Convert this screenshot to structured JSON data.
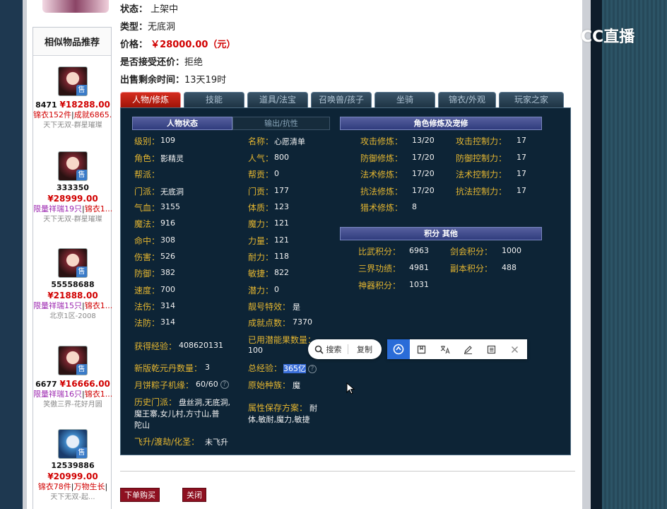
{
  "watermark": {
    "text": "CC直播"
  },
  "sidebar": {
    "title": "相似物品推荐",
    "sale_badge": "售",
    "items": [
      {
        "id": "8471",
        "price": "¥18288.00",
        "tag1": "锦衣152件",
        "tag2": "成就6865...",
        "server": "天下无双-群星璀璨"
      },
      {
        "id": "333350",
        "price": "¥28999.00",
        "tag1": "限量祥瑞19只",
        "tag2": "锦衣1...",
        "server": "天下无双-群星璀璨"
      },
      {
        "id": "55558688",
        "price": "¥21888.00",
        "tag1": "限量祥瑞15只",
        "tag2": "锦衣1...",
        "server": "北京1区-2008"
      },
      {
        "id": "6677",
        "price": "¥16666.00",
        "tag1": "限量祥瑞16只",
        "tag2": "锦衣1...",
        "server": "笑傲三界-花好月圆"
      },
      {
        "id": "12539886",
        "price": "¥20999.00",
        "tag1": "锦衣78件",
        "tag2": "万物生长",
        "server": "天下无双-起..."
      }
    ]
  },
  "info": {
    "status_label": "状态：",
    "status_value": "上架中",
    "type_label": "类型：",
    "type_value": "无底洞",
    "price_label": "价格：",
    "price_value": "￥28000.00（元）",
    "bargain_label": "是否接受还价：",
    "bargain_value": "拒绝",
    "remain_label": "出售剩余时间：",
    "remain_value": "13天19时"
  },
  "tabs": [
    "人物/修炼",
    "技能",
    "道具/法宝",
    "召唤兽/孩子",
    "坐骑",
    "锦衣/外观",
    "玩家之家"
  ],
  "sections": {
    "status": "人物状态",
    "output": "输出/抗性",
    "cultivation": "角色修炼及宠修",
    "points": "积分 其他"
  },
  "stats_left": [
    {
      "label": "级别：",
      "value": "109"
    },
    {
      "label": "角色：",
      "value": "影精灵"
    },
    {
      "label": "帮派：",
      "value": ""
    },
    {
      "label": "门派：",
      "value": "无底洞"
    },
    {
      "label": "气血：",
      "value": "3155"
    },
    {
      "label": "魔法：",
      "value": "916"
    },
    {
      "label": "命中：",
      "value": "308"
    },
    {
      "label": "伤害：",
      "value": "526"
    },
    {
      "label": "防御：",
      "value": "382"
    },
    {
      "label": "速度：",
      "value": "700"
    },
    {
      "label": "法伤：",
      "value": "314"
    },
    {
      "label": "法防：",
      "value": "314"
    }
  ],
  "stats_mid": [
    {
      "label": "名称：",
      "value": "心愿清单"
    },
    {
      "label": "人气：",
      "value": "800"
    },
    {
      "label": "帮贡：",
      "value": "0"
    },
    {
      "label": "门贡：",
      "value": "177"
    },
    {
      "label": "体质：",
      "value": "123"
    },
    {
      "label": "魔力：",
      "value": "121"
    },
    {
      "label": "力量：",
      "value": "121"
    },
    {
      "label": "耐力：",
      "value": "118"
    },
    {
      "label": "敏捷：",
      "value": "822"
    },
    {
      "label": "潜力：",
      "value": "0"
    },
    {
      "label": "靓号特效：",
      "value": "是"
    },
    {
      "label": "成就点数：",
      "value": "7370"
    }
  ],
  "cultivation": [
    {
      "label": "攻击修炼：",
      "value": "13/20",
      "label2": "攻击控制力：",
      "value2": "17"
    },
    {
      "label": "防御修炼：",
      "value": "17/20",
      "label2": "防御控制力：",
      "value2": "17"
    },
    {
      "label": "法术修炼：",
      "value": "17/20",
      "label2": "法术控制力：",
      "value2": "17"
    },
    {
      "label": "抗法修炼：",
      "value": "17/20",
      "label2": "抗法控制力：",
      "value2": "17"
    },
    {
      "label": "猎术修炼：",
      "value": "8",
      "label2": "",
      "value2": ""
    }
  ],
  "points": [
    {
      "label": "比武积分：",
      "value": "6963",
      "label2": "剑会积分：",
      "value2": "1000"
    },
    {
      "label": "三界功绩：",
      "value": "4981",
      "label2": "副本积分：",
      "value2": "488"
    },
    {
      "label": "神器积分：",
      "value": "1031",
      "label2": "",
      "value2": ""
    }
  ],
  "extra": {
    "exp_label": "获得经验：",
    "exp_value": "408620131",
    "potential_label": "已用潜能果数量：",
    "potential_value": "100",
    "qiankun_label": "新版乾元丹数量：",
    "qiankun_value": "3",
    "total_exp_label": "总经验：",
    "total_exp_value": "365亿",
    "mooncake_label": "月饼粽子机缘：",
    "mooncake_value": "60/60",
    "race_label": "原始种族：",
    "race_value": "魔",
    "history_label": "历史门派：",
    "history_value1": "盘丝洞,无底洞,",
    "history_value2": "魔王寨,女儿村,方寸山,普",
    "history_value3": "陀山",
    "attr_label": "属性保存方案：",
    "attr_value1": "耐",
    "attr_value2": "体,敏耐,魔力,敏捷",
    "ascend_label": "飞升/渡劫/化圣：",
    "ascend_value": "未飞升",
    "help_glyph": "?"
  },
  "popup": {
    "search": "搜索",
    "copy": "复制"
  },
  "buttons": {
    "buy": "下单购买",
    "close": "关闭"
  }
}
